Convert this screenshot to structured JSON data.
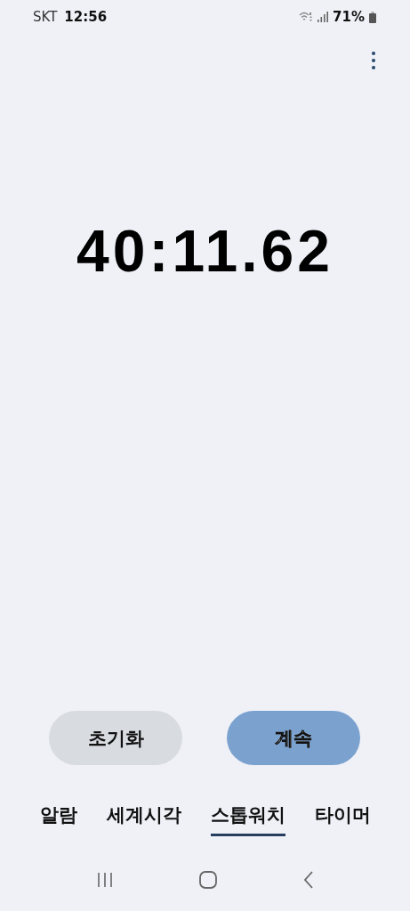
{
  "status_bar": {
    "carrier": "SKT",
    "time": "12:56",
    "battery": "71%"
  },
  "stopwatch": {
    "time": "40:11.62"
  },
  "buttons": [
    {
      "label": "초기화",
      "kind": "secondary"
    },
    {
      "label": "계속",
      "kind": "primary"
    }
  ],
  "tabs": [
    {
      "label": "알람",
      "selected": false
    },
    {
      "label": "세계시각",
      "selected": false
    },
    {
      "label": "스톱워치",
      "selected": true
    },
    {
      "label": "타이머",
      "selected": false
    }
  ]
}
